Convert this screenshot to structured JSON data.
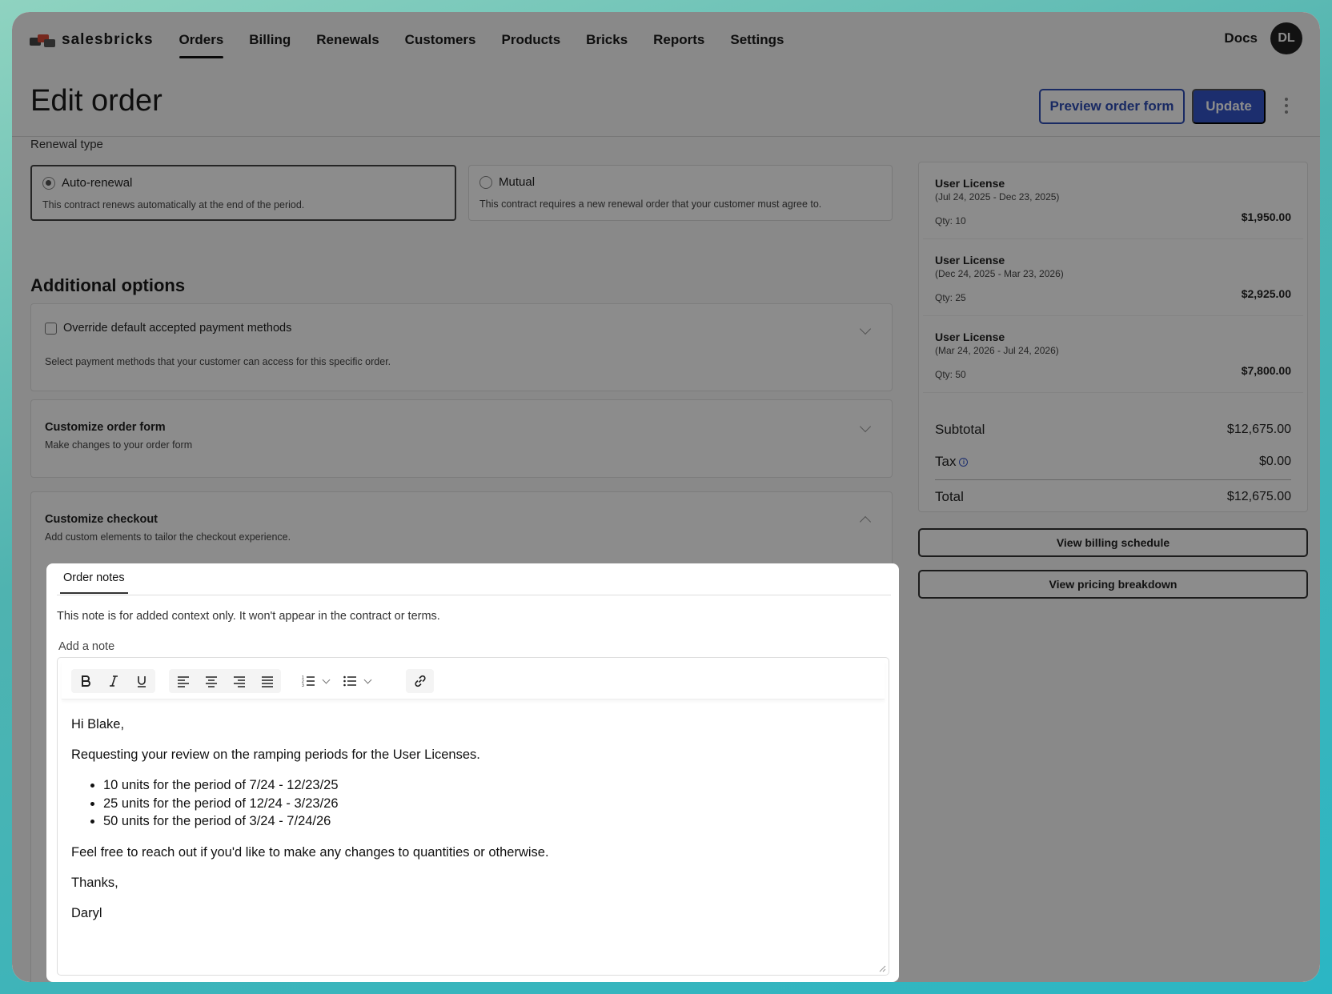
{
  "app": {
    "brand": "salesbricks"
  },
  "nav": [
    {
      "label": "Orders",
      "active": true
    },
    {
      "label": "Billing"
    },
    {
      "label": "Renewals"
    },
    {
      "label": "Customers"
    },
    {
      "label": "Products"
    },
    {
      "label": "Bricks"
    },
    {
      "label": "Reports"
    },
    {
      "label": "Settings"
    }
  ],
  "topbar": {
    "docs": "Docs",
    "avatar_initials": "DL"
  },
  "header": {
    "title": "Edit order",
    "preview_label": "Preview order form",
    "update_label": "Update"
  },
  "renewal": {
    "label": "Renewal type",
    "options": [
      {
        "label": "Auto-renewal",
        "desc": "This contract renews automatically at the end of the period.",
        "selected": true
      },
      {
        "label": "Mutual",
        "desc": "This contract requires a new renewal order that your customer must agree to.",
        "selected": false
      }
    ]
  },
  "additional": {
    "title": "Additional options",
    "payment": {
      "label": "Override default accepted payment methods",
      "desc": "Select payment methods that your customer can access for this specific order."
    },
    "order_form": {
      "label": "Customize order form",
      "desc": "Make changes to your order form"
    },
    "checkout": {
      "label": "Customize checkout",
      "desc": "Add custom elements to tailor the checkout experience."
    }
  },
  "summary": {
    "items": [
      {
        "name": "User License",
        "period": "(Jul 24, 2025 - Dec 23, 2025)",
        "qty": "Qty: 10",
        "price": "$1,950.00"
      },
      {
        "name": "User License",
        "period": "(Dec 24, 2025 - Mar 23, 2026)",
        "qty": "Qty: 25",
        "price": "$2,925.00"
      },
      {
        "name": "User License",
        "period": "(Mar 24, 2026 - Jul 24, 2026)",
        "qty": "Qty: 50",
        "price": "$7,800.00"
      }
    ],
    "subtotal_label": "Subtotal",
    "subtotal": "$12,675.00",
    "tax_label": "Tax",
    "tax": "$0.00",
    "total_label": "Total",
    "total": "$12,675.00",
    "billing_btn": "View billing schedule",
    "pricing_btn": "View pricing breakdown"
  },
  "notes": {
    "tab": "Order notes",
    "info": "This note is for added context only. It won't appear in the contract or terms.",
    "add_label": "Add a note",
    "greeting": "Hi Blake,",
    "request": "Requesting your review on the ramping periods for the User Licenses.",
    "bullets": [
      "10 units for the period of 7/24 - 12/23/25",
      "25 units for the period of 12/24 - 3/23/26",
      "50 units for the period of 3/24 - 7/24/26"
    ],
    "followup": "Feel free to reach out if you'd like to make any changes to quantities or otherwise.",
    "thanks": "Thanks,",
    "signature": "Daryl"
  }
}
